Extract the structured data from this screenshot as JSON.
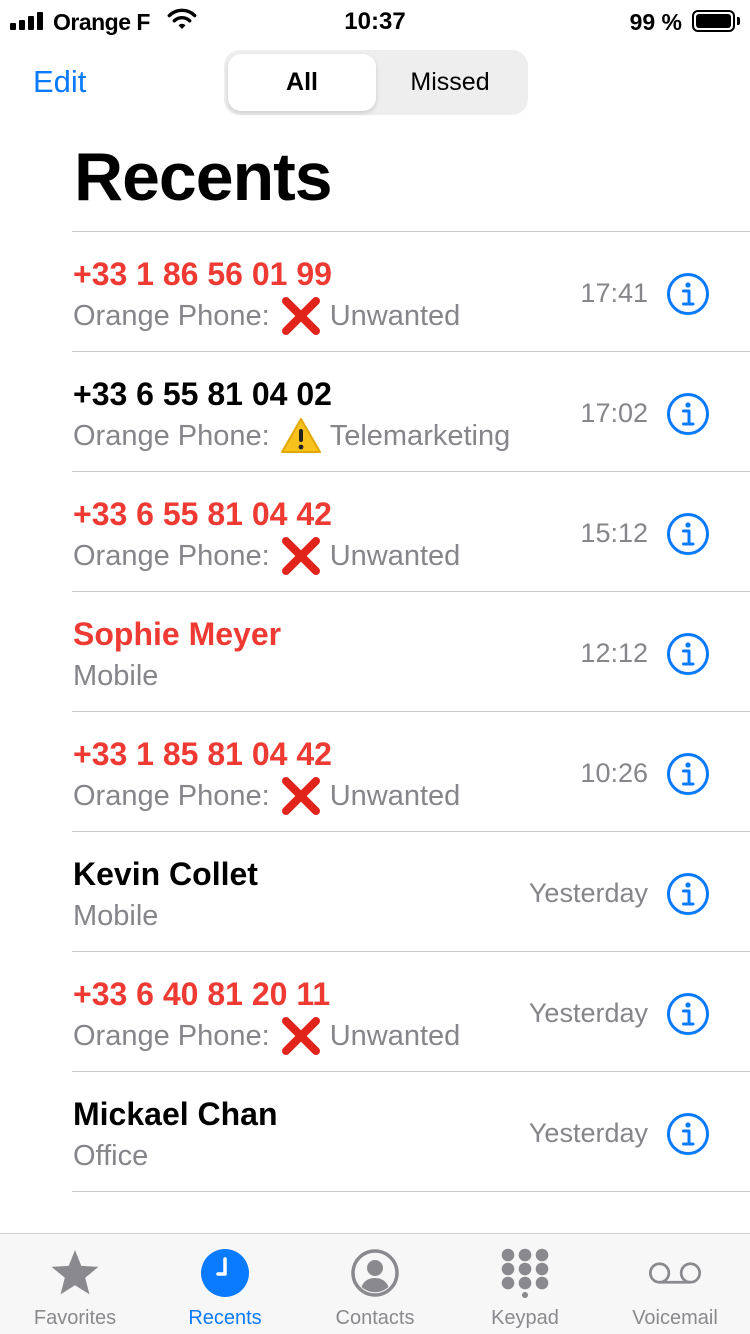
{
  "status_bar": {
    "carrier": "Orange F",
    "time": "10:37",
    "battery": "99 %",
    "battery_level": 0.99
  },
  "nav": {
    "edit_label": "Edit",
    "segments": [
      {
        "label": "All",
        "active": true
      },
      {
        "label": "Missed",
        "active": false
      }
    ]
  },
  "title": "Recents",
  "calls": [
    {
      "name": "+33 1 86 56 01 99",
      "missed": true,
      "sub_prefix": "Orange Phone:",
      "mark": "red-cross",
      "sub_suffix": "Unwanted",
      "time": "17:41"
    },
    {
      "name": "+33 6 55 81 04 02",
      "missed": false,
      "sub_prefix": "Orange Phone:",
      "mark": "warning",
      "sub_suffix": "Telemarketing",
      "time": "17:02"
    },
    {
      "name": "+33 6 55 81 04 42",
      "missed": true,
      "sub_prefix": "Orange Phone:",
      "mark": "red-cross",
      "sub_suffix": "Unwanted",
      "time": "15:12"
    },
    {
      "name": "Sophie Meyer",
      "missed": true,
      "sub_prefix": "Mobile",
      "mark": "",
      "sub_suffix": "",
      "time": "12:12"
    },
    {
      "name": "+33 1 85 81 04 42",
      "missed": true,
      "sub_prefix": "Orange Phone:",
      "mark": "red-cross",
      "sub_suffix": "Unwanted",
      "time": "10:26"
    },
    {
      "name": "Kevin Collet",
      "missed": false,
      "sub_prefix": "Mobile",
      "mark": "",
      "sub_suffix": "",
      "time": "Yesterday"
    },
    {
      "name": "+33 6 40 81 20 11",
      "missed": true,
      "sub_prefix": "Orange Phone:",
      "mark": "red-cross",
      "sub_suffix": "Unwanted",
      "time": "Yesterday"
    },
    {
      "name": "Mickael Chan",
      "missed": false,
      "sub_prefix": "Office",
      "mark": "",
      "sub_suffix": "",
      "time": "Yesterday"
    }
  ],
  "tabs": [
    {
      "label": "Favorites",
      "icon": "star-icon",
      "active": false
    },
    {
      "label": "Recents",
      "icon": "clock-icon",
      "active": true
    },
    {
      "label": "Contacts",
      "icon": "person-circle-icon",
      "active": false
    },
    {
      "label": "Keypad",
      "icon": "keypad-icon",
      "active": false
    },
    {
      "label": "Voicemail",
      "icon": "voicemail-icon",
      "active": false
    }
  ],
  "colors": {
    "accent": "#0a7aff",
    "missed": "#ee3a32",
    "secondary_text": "#85858a",
    "inactive_tab": "#8a8a8e"
  }
}
